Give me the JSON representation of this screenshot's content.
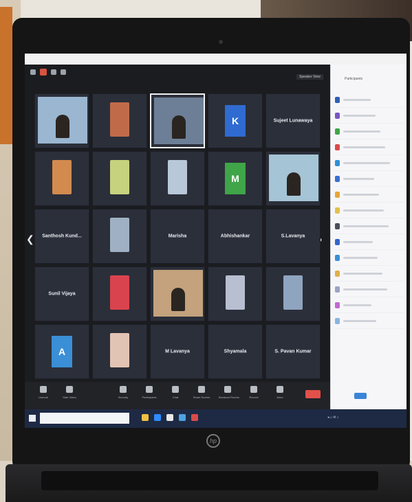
{
  "scene": {
    "device": "laptop",
    "brand_logo_text": "hp"
  },
  "meeting": {
    "view_label": "Speaker View",
    "tiles": [
      {
        "name": "",
        "caption": "",
        "kind": "video",
        "tone": "#9ab6d0"
      },
      {
        "name": "",
        "caption": "",
        "kind": "photo",
        "tone": "#c06a4a"
      },
      {
        "name": "",
        "caption": "",
        "kind": "video-active",
        "tone": "#6d7f96"
      },
      {
        "name": "",
        "caption": "",
        "kind": "letter",
        "letter": "K",
        "tone": "#2f6bd1"
      },
      {
        "name": "Sujeet Lunawaya",
        "caption": "",
        "kind": "name"
      },
      {
        "name": "",
        "caption": "",
        "kind": "photo",
        "tone": "#d38a4e"
      },
      {
        "name": "",
        "caption": "",
        "kind": "photo",
        "tone": "#c7d27e"
      },
      {
        "name": "",
        "caption": "",
        "kind": "photo",
        "tone": "#b8c8d8"
      },
      {
        "name": "",
        "caption": "",
        "kind": "letter",
        "letter": "M",
        "tone": "#3fa548"
      },
      {
        "name": "",
        "caption": "",
        "kind": "video",
        "tone": "#a5c4d6"
      },
      {
        "name": "Santhosh Kund...",
        "caption": "",
        "kind": "name"
      },
      {
        "name": "",
        "caption": "",
        "kind": "photo",
        "tone": "#9fb0c4"
      },
      {
        "name": "Marisha",
        "caption": "",
        "kind": "name"
      },
      {
        "name": "Abhishankar",
        "caption": "",
        "kind": "name"
      },
      {
        "name": "S.Lavanya",
        "caption": "",
        "kind": "name"
      },
      {
        "name": "Sunil Vijaya",
        "caption": "",
        "kind": "name"
      },
      {
        "name": "",
        "caption": "",
        "kind": "photo",
        "tone": "#d9434e"
      },
      {
        "name": "",
        "caption": "",
        "kind": "video",
        "tone": "#c3a27d"
      },
      {
        "name": "",
        "caption": "",
        "kind": "photo",
        "tone": "#b7bfd0"
      },
      {
        "name": "",
        "caption": "",
        "kind": "photo",
        "tone": "#8fa4bf"
      },
      {
        "name": "",
        "caption": "",
        "kind": "letter",
        "letter": "A",
        "tone": "#3a8fd6"
      },
      {
        "name": "",
        "caption": "",
        "kind": "photo",
        "tone": "#e2c4b4"
      },
      {
        "name": "M Lavanya",
        "caption": "",
        "kind": "name"
      },
      {
        "name": "Shyamala",
        "caption": "",
        "kind": "name"
      },
      {
        "name": "S. Pavan Kumar",
        "caption": "",
        "kind": "name"
      }
    ],
    "toolbar": [
      {
        "label": "Unmute",
        "icon": "microphone-icon"
      },
      {
        "label": "Start Video",
        "icon": "camera-icon"
      },
      {
        "label": "Security",
        "icon": "shield-icon"
      },
      {
        "label": "Participants",
        "icon": "people-icon"
      },
      {
        "label": "Chat",
        "icon": "chat-icon"
      },
      {
        "label": "Share Screen",
        "icon": "share-icon"
      },
      {
        "label": "Breakout Rooms",
        "icon": "rooms-icon"
      },
      {
        "label": "Record",
        "icon": "record-icon"
      },
      {
        "label": "More",
        "icon": "more-icon"
      }
    ],
    "end_label": ""
  },
  "panel": {
    "title": "Participants",
    "avatar_colors": [
      "#2f5fb4",
      "#7a56c2",
      "#3fa548",
      "#d94b4b",
      "#2f8fd6",
      "#3a6fd1",
      "#e6a63a",
      "#e2c14c",
      "#4a4f5a",
      "#3366cc",
      "#3a8fd6",
      "#e0b04a",
      "#9aa3c4",
      "#c06ad0",
      "#8ab4e0"
    ]
  },
  "colors": {
    "accent": "#2d8cff",
    "end_red": "#e3504a",
    "zoom_dark": "#1b1c1f"
  }
}
